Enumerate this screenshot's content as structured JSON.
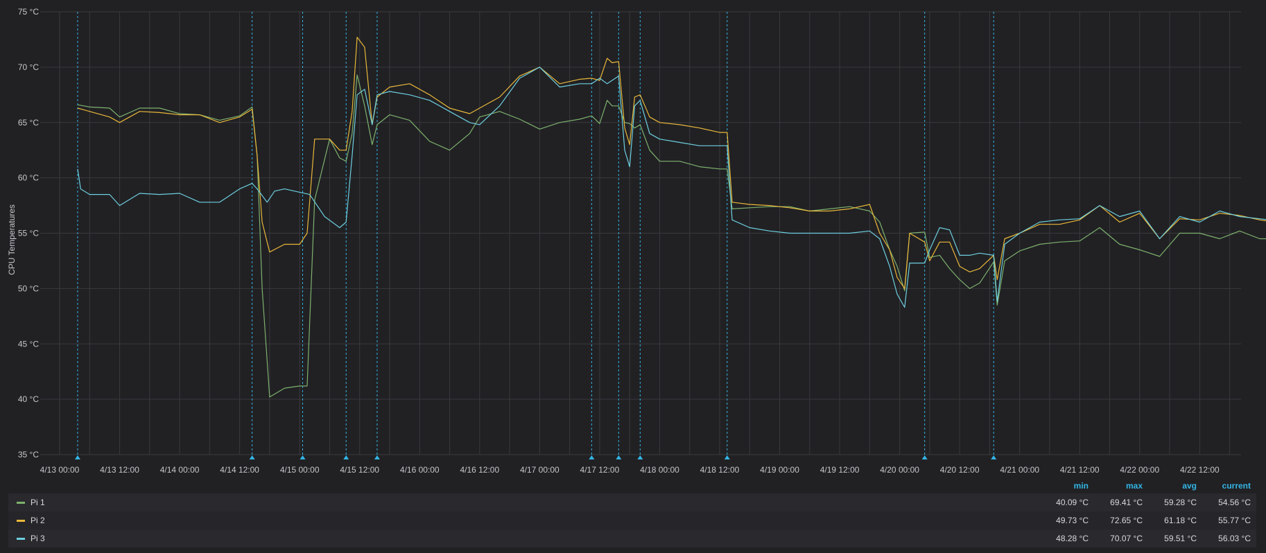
{
  "chart_data": {
    "type": "line",
    "ylabel": "CPU Temperatures",
    "y_unit": "°C",
    "ylim": [
      35,
      75
    ],
    "y_ticks": [
      "35 °C",
      "40 °C",
      "45 °C",
      "50 °C",
      "55 °C",
      "60 °C",
      "65 °C",
      "70 °C",
      "75 °C"
    ],
    "y_tick_values": [
      35,
      40,
      45,
      50,
      55,
      60,
      65,
      70,
      75
    ],
    "xlim_hours": [
      0,
      246
    ],
    "x_ticks": [
      "4/13 00:00",
      "4/13 12:00",
      "4/14 00:00",
      "4/14 12:00",
      "4/15 00:00",
      "4/15 12:00",
      "4/16 00:00",
      "4/16 12:00",
      "4/17 00:00",
      "4/17 12:00",
      "4/18 00:00",
      "4/18 12:00",
      "4/19 00:00",
      "4/19 12:00",
      "4/20 00:00",
      "4/20 12:00",
      "4/21 00:00",
      "4/21 12:00",
      "4/22 00:00",
      "4/22 12:00"
    ],
    "x_tick_hours": [
      0,
      12,
      24,
      36,
      48,
      60,
      72,
      84,
      96,
      108,
      120,
      132,
      144,
      156,
      168,
      180,
      192,
      204,
      216,
      228
    ],
    "annotation_hours": [
      3.6,
      38.5,
      48.6,
      57.3,
      63.5,
      106.4,
      111.8,
      116.1,
      133.5,
      173.0,
      186.8
    ],
    "grid": true,
    "legend_position": "bottom",
    "series": [
      {
        "name": "Pi 1",
        "color": "#7eb26d",
        "x": [
          3.6,
          6,
          10,
          12,
          16,
          20,
          24,
          28,
          32,
          36,
          38.5,
          39.5,
          40.5,
          42,
          45,
          48,
          49.5,
          51,
          54,
          56,
          57.3,
          58.5,
          59.5,
          61,
          62.5,
          63.5,
          66,
          70,
          74,
          78,
          82,
          84,
          88,
          92,
          96,
          100,
          104,
          106.4,
          108,
          109.5,
          110.5,
          111.8,
          113,
          114,
          115,
          116.1,
          118,
          120,
          124,
          128,
          132,
          133.5,
          134.5,
          138,
          142,
          146,
          150,
          154,
          158,
          162,
          164,
          166,
          167.5,
          169,
          170,
          173,
          174,
          176,
          178,
          180,
          182,
          184,
          186.8,
          187.5,
          189,
          192,
          196,
          200,
          204,
          208,
          212,
          216,
          220,
          224,
          228,
          232,
          236,
          240,
          246
        ],
        "y": [
          66.6,
          66.4,
          66.3,
          65.5,
          66.3,
          66.3,
          65.8,
          65.7,
          65.2,
          65.6,
          66.4,
          62.0,
          50.0,
          40.2,
          41.0,
          41.2,
          41.2,
          58.0,
          63.5,
          61.8,
          61.5,
          64.0,
          69.3,
          66.5,
          63.0,
          64.8,
          65.7,
          65.2,
          63.3,
          62.5,
          64.0,
          65.5,
          66.0,
          65.3,
          64.4,
          65.0,
          65.3,
          65.6,
          64.9,
          67.0,
          66.5,
          66.5,
          65.0,
          64.9,
          64.5,
          64.8,
          62.5,
          61.5,
          61.5,
          61.0,
          60.8,
          60.8,
          57.2,
          57.3,
          57.4,
          57.4,
          57.0,
          57.2,
          57.4,
          57.0,
          56.0,
          53.5,
          52.0,
          49.8,
          55.0,
          55.1,
          52.8,
          53.0,
          51.8,
          50.8,
          50.0,
          50.5,
          52.4,
          48.5,
          52.5,
          53.4,
          54.0,
          54.2,
          54.3,
          55.5,
          54.0,
          53.5,
          52.9,
          55.0,
          55.0,
          54.5,
          55.2,
          54.5,
          54.5
        ]
      },
      {
        "name": "Pi 2",
        "color": "#eab839",
        "x": [
          3.6,
          6,
          10,
          12,
          16,
          20,
          24,
          28,
          32,
          36,
          38.5,
          39.5,
          40.5,
          42,
          45,
          48,
          49.5,
          51,
          54,
          56,
          57.3,
          58.5,
          59.5,
          61,
          62.5,
          63.5,
          66,
          70,
          74,
          78,
          82,
          84,
          88,
          92,
          96,
          100,
          104,
          106.4,
          108,
          109.5,
          110.5,
          111.8,
          113,
          114,
          115,
          116.1,
          118,
          120,
          124,
          128,
          132,
          133.5,
          134.5,
          138,
          142,
          146,
          150,
          154,
          158,
          162,
          164,
          166,
          167.5,
          169,
          170,
          173,
          174,
          176,
          178,
          180,
          182,
          184,
          186.8,
          187.5,
          189,
          192,
          196,
          200,
          204,
          208,
          212,
          216,
          220,
          224,
          228,
          232,
          236,
          240,
          246
        ],
        "y": [
          66.3,
          66.0,
          65.5,
          65.0,
          66.0,
          65.9,
          65.7,
          65.7,
          65.0,
          65.5,
          66.2,
          62.0,
          56.0,
          53.3,
          54.0,
          54.0,
          55.0,
          63.5,
          63.5,
          62.5,
          62.5,
          66.0,
          72.7,
          71.8,
          64.8,
          67.3,
          68.2,
          68.5,
          67.5,
          66.3,
          65.8,
          66.3,
          67.3,
          69.2,
          70.0,
          68.5,
          68.9,
          69.0,
          68.8,
          70.8,
          70.4,
          70.5,
          64.5,
          63.0,
          67.3,
          67.5,
          65.5,
          65.0,
          64.8,
          64.5,
          64.1,
          64.1,
          57.8,
          57.6,
          57.5,
          57.3,
          57.0,
          57.0,
          57.2,
          57.6,
          55.0,
          53.5,
          51.0,
          50.0,
          55.0,
          54.2,
          52.5,
          54.2,
          54.2,
          52.0,
          51.5,
          51.8,
          53.0,
          50.8,
          54.5,
          55.0,
          55.8,
          55.8,
          56.2,
          57.5,
          56.0,
          56.8,
          54.5,
          56.3,
          56.2,
          56.8,
          56.6,
          56.2,
          55.8
        ]
      },
      {
        "name": "Pi 3",
        "color": "#6ed0e0",
        "x": [
          3.6,
          4.2,
          6,
          10,
          12,
          16,
          20,
          24,
          28,
          32,
          36,
          38.5,
          39.5,
          41.5,
          43,
          45,
          48,
          50,
          53,
          56,
          57.3,
          58.5,
          59.5,
          61,
          62.5,
          63.5,
          66,
          70,
          74,
          78,
          82,
          84,
          88,
          92,
          96,
          100,
          104,
          106.4,
          108,
          109.5,
          110.5,
          111.8,
          113,
          114,
          115,
          116.1,
          118,
          120,
          124,
          128,
          132,
          133.5,
          134.5,
          138,
          142,
          146,
          150,
          154,
          158,
          162,
          164,
          166,
          167.5,
          169,
          170,
          173,
          174,
          176,
          178,
          180,
          182,
          184,
          186.8,
          187.5,
          189,
          192,
          196,
          200,
          204,
          208,
          212,
          216,
          220,
          224,
          228,
          232,
          236,
          240,
          246
        ],
        "y": [
          60.8,
          59.0,
          58.5,
          58.5,
          57.5,
          58.6,
          58.5,
          58.6,
          57.8,
          57.8,
          59.0,
          59.5,
          59.0,
          57.8,
          58.8,
          59.0,
          58.7,
          58.5,
          56.5,
          55.5,
          56.0,
          62.0,
          67.5,
          68.0,
          64.8,
          67.5,
          67.8,
          67.5,
          67.0,
          66.0,
          65.0,
          64.8,
          66.5,
          69.0,
          70.0,
          68.2,
          68.5,
          68.5,
          69.0,
          68.5,
          68.8,
          69.2,
          62.5,
          61.0,
          66.5,
          67.0,
          64.0,
          63.5,
          63.2,
          62.9,
          62.9,
          62.9,
          56.2,
          55.5,
          55.2,
          55.0,
          55.0,
          55.0,
          55.0,
          55.2,
          54.5,
          52.0,
          49.5,
          48.3,
          52.3,
          52.3,
          53.5,
          55.5,
          55.3,
          53.0,
          53.0,
          53.2,
          53.0,
          48.8,
          54.0,
          55.0,
          56.0,
          56.2,
          56.3,
          57.5,
          56.5,
          57.0,
          54.5,
          56.5,
          56.0,
          57.0,
          56.5,
          56.3,
          56.0
        ]
      }
    ],
    "legend": {
      "headers": [
        "min",
        "max",
        "avg",
        "current"
      ],
      "rows": [
        {
          "name": "Pi 1",
          "color": "#7eb26d",
          "min": "40.09 °C",
          "max": "69.41 °C",
          "avg": "59.28 °C",
          "current": "54.56 °C"
        },
        {
          "name": "Pi 2",
          "color": "#eab839",
          "min": "49.73 °C",
          "max": "72.65 °C",
          "avg": "61.18 °C",
          "current": "55.77 °C"
        },
        {
          "name": "Pi 3",
          "color": "#6ed0e0",
          "min": "48.28 °C",
          "max": "70.07 °C",
          "avg": "59.51 °C",
          "current": "56.03 °C"
        }
      ]
    }
  }
}
